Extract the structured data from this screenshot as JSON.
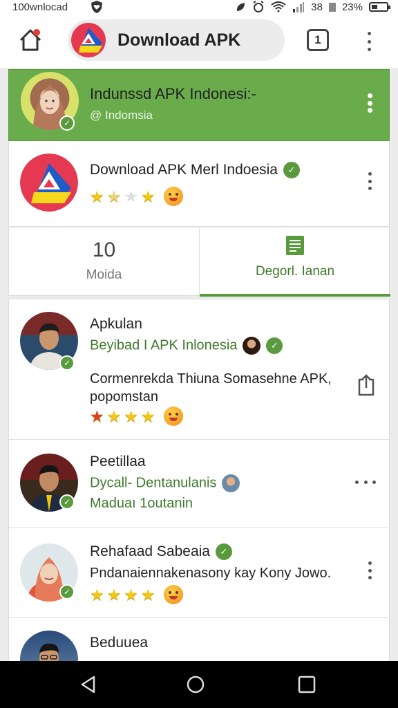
{
  "status_bar": {
    "left_text": "100wnlocad",
    "right_num": "38",
    "battery": "23%"
  },
  "toolbar": {
    "title": "Download APK",
    "tabs_count": "1"
  },
  "colors": {
    "accent_green": "#6aac4c",
    "verified_green": "#5a9a3e",
    "text_green": "#3d7a2a"
  },
  "profile_banner": {
    "name": "Indunssd APK Indonesi:-",
    "location": "@ Indomsia"
  },
  "app_card": {
    "title": "Download APK Merl Indoesia",
    "rating_stars": 4
  },
  "stats_tabs": [
    {
      "value": "10",
      "label": "Moida"
    },
    {
      "label": "Degorl. Ianan",
      "icon": "document-list-icon"
    }
  ],
  "feed": [
    {
      "name": "Apkulan",
      "subtitle": "Beyibad I APK Inlonesia",
      "body": "Cormenrekda Thiuna Somasehne APK,\npopomstan",
      "rating_stars": 4
    },
    {
      "name": "Peetillaa",
      "subtitle": "Dycall- Dentanulanis",
      "line3": "Maduaı 1outanin"
    },
    {
      "name": "Rehafaad Sabeaia",
      "subtitle": "Pndanaiennakenasony kay Kony Jowo.",
      "rating_stars": 4
    },
    {
      "name": "Beduuea"
    }
  ]
}
